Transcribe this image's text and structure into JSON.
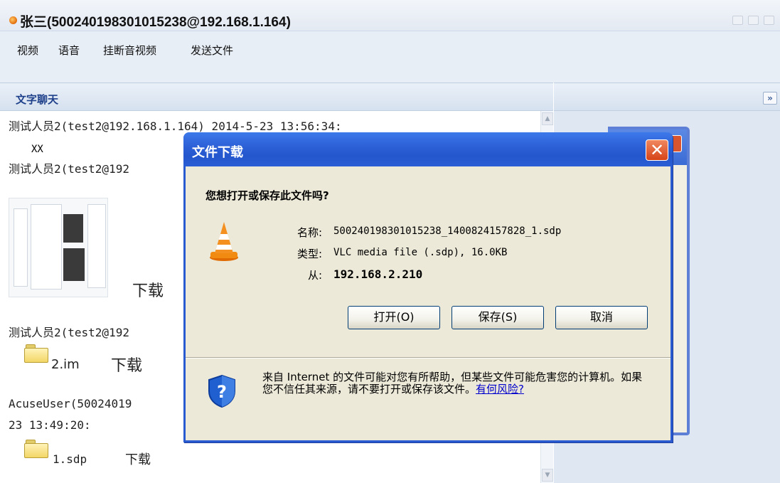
{
  "window": {
    "title": "张三(500240198301015238@192.168.1.164)"
  },
  "menu": {
    "items": [
      "视频",
      "语音",
      "挂断音视频",
      "发送文件"
    ]
  },
  "chat": {
    "header": "文字聊天",
    "messages": [
      {
        "sender": "测试人员2(test2@192.168.1.164) 2014-5-23 13:56:34:",
        "content": "XX"
      },
      {
        "sender": "测试人员2(test2@192",
        "content_download": "下载"
      },
      {
        "sender": "测试人员2(test2@192",
        "file": "2.im",
        "download": "下载"
      },
      {
        "sender": "AcuseUser(50024019",
        "sender_line2": "23 13:49:20:",
        "file": "1.sdp",
        "download": "下载"
      }
    ]
  },
  "right_panel": {
    "expand_label": "»"
  },
  "dialog": {
    "title": "文件下载",
    "close_label": "✕",
    "question": "您想打开或保存此文件吗?",
    "name_label": "名称:",
    "name_value": "500240198301015238_1400824157828_1.sdp",
    "type_label": "类型:",
    "type_value": "VLC media file (.sdp), 16.0KB",
    "from_label": "从:",
    "from_value": "192.168.2.210",
    "open_button": "打开(O)",
    "save_button": "保存(S)",
    "cancel_button": "取消",
    "warning_text": "来自 Internet 的文件可能对您有所帮助，但某些文件可能危害您的计算机。如果您不信任其来源，请不要打开或保存该文件。",
    "warning_link": "有何风险?"
  }
}
